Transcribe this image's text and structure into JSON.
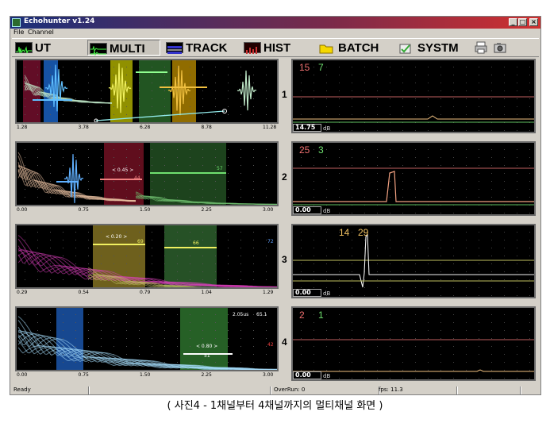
{
  "window": {
    "title": "Echohunter v1.24",
    "controls": [
      "_",
      "□",
      "×"
    ]
  },
  "menu": [
    "File",
    "Channel"
  ],
  "toolbar": {
    "buttons": [
      {
        "label": "UT",
        "icon": "ut-waveform-icon"
      },
      {
        "label": "MULTI",
        "icon": "multi-waveform-icon",
        "active": true
      },
      {
        "label": "TRACK",
        "icon": "track-grid-icon"
      },
      {
        "label": "HIST",
        "icon": "histogram-icon"
      },
      {
        "label": "BATCH",
        "icon": "folder-icon"
      },
      {
        "label": "SYSTM",
        "icon": "system-settings-icon"
      }
    ],
    "extra_icons": [
      "printer-icon",
      "camera-icon"
    ]
  },
  "channels": [
    {
      "number": "1",
      "axis_ticks": [
        "1.28",
        "3.78",
        "6.28",
        "8.78",
        "11.28"
      ],
      "gain": "14.75",
      "gain_unit": "dB",
      "track_values": [
        "15",
        "7"
      ],
      "track_colors": [
        "#f07070",
        "#70e070"
      ]
    },
    {
      "number": "2",
      "axis_ticks": [
        "0.00",
        "0.75",
        "1.50",
        "2.25",
        "3.00"
      ],
      "gate_label": "< 0.45 >",
      "gate_value_a": "44",
      "gate_value_b": "57",
      "gain": "0.00",
      "gain_unit": "dB",
      "track_values": [
        "25",
        "3"
      ],
      "track_colors": [
        "#f07070",
        "#70e070"
      ]
    },
    {
      "number": "3",
      "axis_ticks": [
        "0.29",
        "0.54",
        "0.79",
        "1.04",
        "1.29"
      ],
      "gate_label": "< 0.20 >",
      "gate_value_a": "69",
      "gate_value_b": "66",
      "side_value": "72",
      "gain": "0.00",
      "gain_unit": "dB",
      "track_values": [
        "14",
        "29"
      ],
      "track_colors": [
        "#f0c060",
        "#f0c060"
      ]
    },
    {
      "number": "4",
      "axis_ticks": [
        "0.00",
        "0.75",
        "1.50",
        "2.25",
        "3.00"
      ],
      "gate_label": "< 0.80 >",
      "gate_value_a": "51",
      "side_value": "42",
      "readout_time": "2.05us",
      "readout_value": "65.1",
      "gain": "0.00",
      "gain_unit": "dB",
      "track_values": [
        "2",
        "1"
      ],
      "track_colors": [
        "#f07070",
        "#70e070"
      ]
    }
  ],
  "statusbar": {
    "ready": "Ready",
    "overrun": "OverRun: 0",
    "fps": "fps: 11.3"
  },
  "caption": "( 사진4 - 1채널부터 4채널까지의 멀티채널 화면 )"
}
